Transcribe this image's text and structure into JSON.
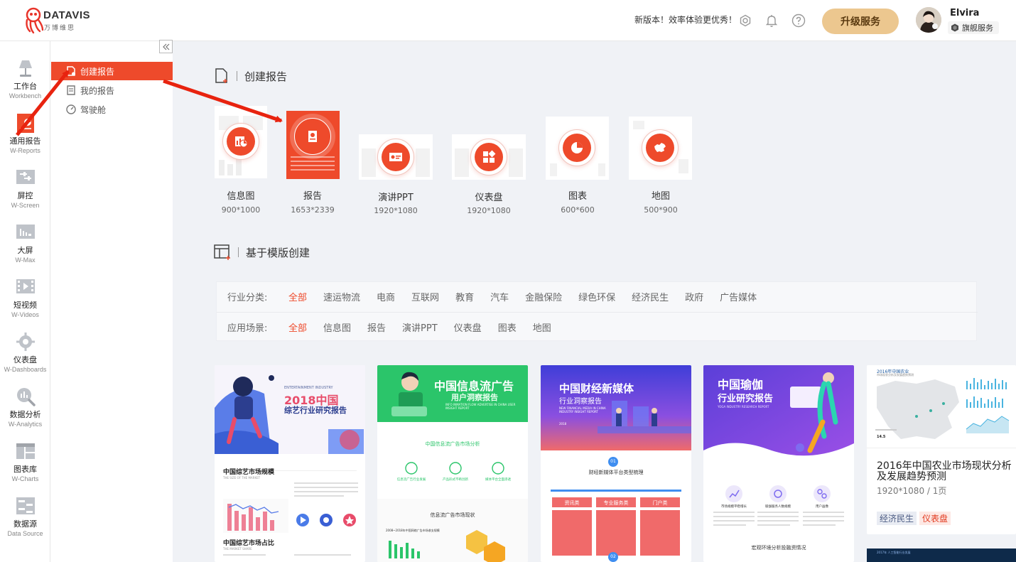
{
  "brand": {
    "name": "DATAVIS",
    "sub": "万博维思"
  },
  "header": {
    "notice": "新版本！效率体验更优秀！",
    "upgrade_label": "升级服务",
    "user_name": "Elvira",
    "user_tier": "旗舰服务"
  },
  "leftnav": [
    {
      "label": "工作台",
      "sub": "Workbench"
    },
    {
      "label": "通用报告",
      "sub": "W-Reports"
    },
    {
      "label": "屏控",
      "sub": "W-Screen"
    },
    {
      "label": "大屏",
      "sub": "W-Max"
    },
    {
      "label": "短视频",
      "sub": "W-Videos"
    },
    {
      "label": "仪表盘",
      "sub": "W-Dashboards"
    },
    {
      "label": "数据分析",
      "sub": "W-Analytics"
    },
    {
      "label": "图表库",
      "sub": "W-Charts"
    },
    {
      "label": "数据源",
      "sub": "Data Source"
    }
  ],
  "subnav": [
    {
      "label": "创建报告"
    },
    {
      "label": "我的报告"
    },
    {
      "label": "驾驶舱"
    }
  ],
  "section_create": {
    "title": "创建报告"
  },
  "create_types": [
    {
      "name": "信息图",
      "size": "900*1000"
    },
    {
      "name": "报告",
      "size": "1653*2339"
    },
    {
      "name": "演讲PPT",
      "size": "1920*1080"
    },
    {
      "name": "仪表盘",
      "size": "1920*1080"
    },
    {
      "name": "图表",
      "size": "600*600"
    },
    {
      "name": "地图",
      "size": "500*900"
    }
  ],
  "section_template": {
    "title": "基于模版创建"
  },
  "filters": {
    "industry": {
      "label": "行业分类:",
      "options": [
        "全部",
        "速运物流",
        "电商",
        "互联网",
        "教育",
        "汽车",
        "金融保险",
        "绿色环保",
        "经济民生",
        "政府",
        "广告媒体"
      ]
    },
    "scene": {
      "label": "应用场景:",
      "options": [
        "全部",
        "信息图",
        "报告",
        "演讲PPT",
        "仪表盘",
        "图表",
        "地图"
      ]
    }
  },
  "templates": [
    {
      "head_en": "ENTERTAINMENT INDUSTRY",
      "title": "2018中国",
      "subtitle": "综艺行业研究报告",
      "sec1": "中国综艺市场规模",
      "sec1_en": "THE SIZE OF THE MARKET",
      "sec2": "中国综艺市场占比",
      "sec2_en": "THE MARKET SHARE"
    },
    {
      "title": "中国信息流广告",
      "subtitle": "用户洞察报告",
      "en": "INFO INMATION FLOW ADVERTISE IN CHINA USER INSIGHT REPORT",
      "sec1": "中国信息流广告市场分析",
      "items": [
        "信息流广告行业发展",
        "产品形式不断创新",
        "媒体平台全面渗透"
      ],
      "sec2": "信息流广告市场现状",
      "sec2_sub": "2008~2018年中国网络广告市场收支规模"
    },
    {
      "title": "中国财经新媒体",
      "subtitle": "行业洞察报告",
      "en": "NEW FINANCIAL MEDIA IN CHINA INDUSTRY INSIGHT REPORT",
      "year": "2018",
      "num1": "01",
      "sec1": "财经新媒体平台类型梳理",
      "cols": [
        "资讯类",
        "专业服务类",
        "门户类"
      ],
      "num2": "02"
    },
    {
      "title": "中国瑜伽",
      "subtitle": "行业研究报告",
      "en": "YOGA INDUSTRY RESEARCH REPORT",
      "items": [
        "市场规模平稳增长",
        "瑜伽服务人数规模",
        "用户画像"
      ],
      "sec2": "宏观环境分析投融资情况"
    },
    {
      "mini_title": "2016年中国农业",
      "mini_sub": "市场现状分析及发展趋势预测",
      "mini_num": "14.5",
      "title": "2016年中国农业市场现状分析及发展趋势预测",
      "meta": "1920*1080 / 1页",
      "tags": [
        "经济民生",
        "仪表盘"
      ],
      "next_en": "2017年 人工智能行业发展"
    }
  ],
  "colors": {
    "accent": "#ee4a2b",
    "gold": "#ecc78f"
  }
}
